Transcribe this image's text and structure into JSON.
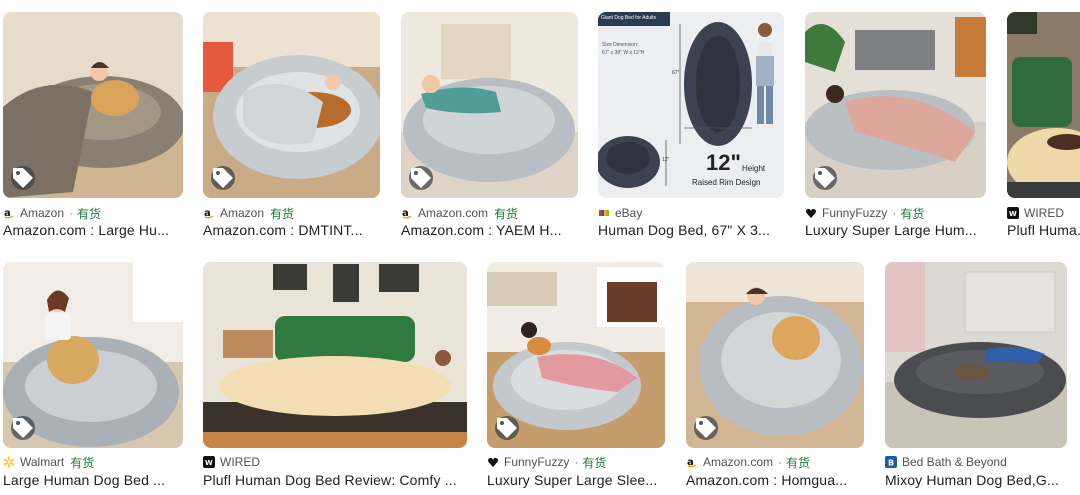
{
  "in_stock_label": "有货",
  "results": [
    {
      "source": "Amazon",
      "title": "Amazon.com : Large Hu...",
      "favicon": "amazon-icon",
      "in_stock": true
    },
    {
      "source": "Amazon",
      "title": "Amazon.com : DMTINT...",
      "favicon": "amazon-icon",
      "in_stock": true
    },
    {
      "source": "Amazon.com",
      "title": "Amazon.com : YAEM H...",
      "favicon": "amazon-icon",
      "in_stock": true
    },
    {
      "source": "eBay",
      "title": "Human Dog Bed, 67\" X 3...",
      "favicon": "ebay-icon",
      "in_stock": false,
      "image_text": {
        "header": "Giant Dog Bed for Adults",
        "dim_label": "Size Dimension:",
        "dims": "67\" x 38\" W x 12\"H",
        "height_big": "12\"",
        "height_word": "Height",
        "raised": "Raised Rim Design",
        "len": "67\"",
        "wid": "38\"",
        "rim": "12\""
      }
    },
    {
      "source": "FunnyFuzzy",
      "title": "Luxury Super Large Hum...",
      "favicon": "funnyfuzzy-icon",
      "in_stock": true
    },
    {
      "source": "WIRED",
      "title": "Plufl Huma...",
      "favicon": "wired-icon",
      "in_stock": false
    },
    {
      "source": "Walmart",
      "title": "Large Human Dog Bed ...",
      "favicon": "walmart-icon",
      "in_stock": true
    },
    {
      "source": "WIRED",
      "title": "Plufl Human Dog Bed Review: Comfy ...",
      "favicon": "wired-icon",
      "in_stock": false
    },
    {
      "source": "FunnyFuzzy",
      "title": "Luxury Super Large Slee...",
      "favicon": "funnyfuzzy-icon",
      "in_stock": true
    },
    {
      "source": "Amazon.com",
      "title": "Amazon.com : Homgua...",
      "favicon": "amazon-icon",
      "in_stock": true
    },
    {
      "source": "Bed Bath & Beyond",
      "title": "Mixoy Human Dog Bed,G...",
      "favicon": "bedbathbeyond-icon",
      "in_stock": false
    }
  ],
  "colors": {
    "stock_green": "#188038",
    "text": "#202124",
    "source_text": "#4d5156"
  }
}
